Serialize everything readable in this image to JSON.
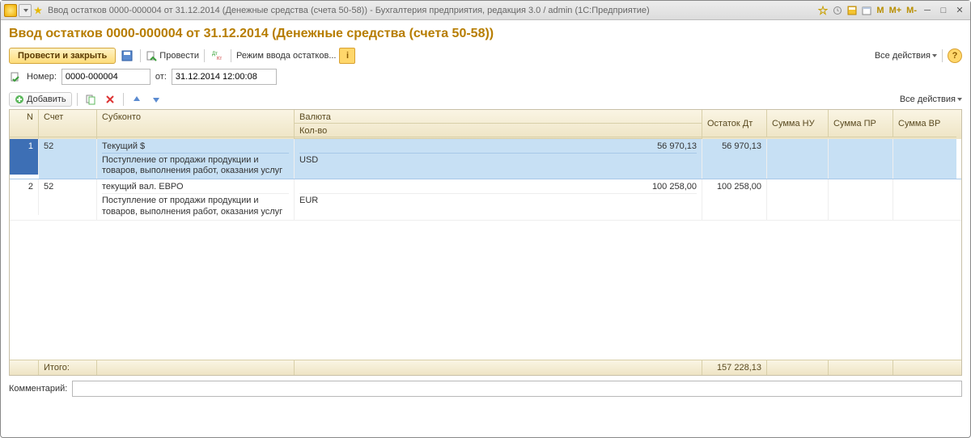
{
  "window": {
    "title": "Ввод остатков 0000-000004 от 31.12.2014 (Денежные средства (счета 50-58)) - Бухгалтерия предприятия, редакция 3.0 / admin  (1С:Предприятие)"
  },
  "header": {
    "title": "Ввод остатков 0000-000004 от 31.12.2014 (Денежные средства (счета 50-58))"
  },
  "toolbar": {
    "post_and_close": "Провести и закрыть",
    "post": "Провести",
    "entry_mode": "Режим ввода остатков...",
    "all_actions": "Все действия"
  },
  "form": {
    "number_label": "Номер:",
    "number_value": "0000-000004",
    "from_label": "от:",
    "date_value": "31.12.2014 12:00:08"
  },
  "table_toolbar": {
    "add": "Добавить",
    "all_actions": "Все действия"
  },
  "grid": {
    "columns": {
      "n": "N",
      "account": "Счет",
      "subconto": "Субконто",
      "currency": "Валюта",
      "qty": "Кол-во",
      "balance_dt": "Остаток Дт",
      "sum_nu": "Сумма НУ",
      "sum_pr": "Сумма ПР",
      "sum_vr": "Сумма ВР"
    },
    "rows": [
      {
        "n": "1",
        "account": "52",
        "sub1": "Текущий $",
        "sub2": "Поступление от продажи продукции и товаров, выполнения работ, оказания услуг",
        "currency": "USD",
        "currency_amount": "56 970,13",
        "balance_dt": "56 970,13"
      },
      {
        "n": "2",
        "account": "52",
        "sub1": "текущий вал. ЕВРО",
        "sub2": "Поступление от продажи продукции и товаров, выполнения работ, оказания услуг",
        "currency": "EUR",
        "currency_amount": "100 258,00",
        "balance_dt": "100 258,00"
      }
    ],
    "footer": {
      "total_label": "Итого:",
      "total_dt": "157 228,13"
    }
  },
  "comment": {
    "label": "Комментарий:",
    "value": ""
  }
}
